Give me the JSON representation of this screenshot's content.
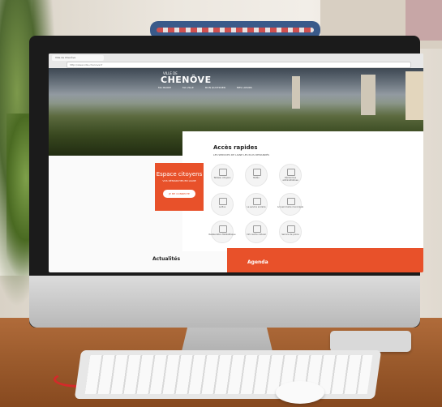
{
  "browser": {
    "tab_title": "Ville de Chenôve",
    "address": "http://www.ville-chenove.fr"
  },
  "site": {
    "logo_small": "VILLE DE",
    "logo_big": "CHENÔVE",
    "nav": [
      "MA MAIRIE",
      "MA VILLE",
      "MON QUOTIDIEN",
      "MES LOISIRS"
    ]
  },
  "acces_rapides": {
    "title": "Accès rapides",
    "subtitle": "LES SERVICES DE LIGNE LES PLUS DEMANDÉS",
    "tiles": [
      {
        "label": "Tableau citoyens",
        "icon": "document-icon"
      },
      {
        "label": "Météo",
        "icon": "cloud-icon"
      },
      {
        "label": "Démarches administratives",
        "icon": "form-icon"
      },
      {
        "label": "Le Bus",
        "icon": "bus-icon"
      },
      {
        "label": "Le service scolaire",
        "icon": "school-icon"
      },
      {
        "label": "Accueil mairie municipale",
        "icon": "city-hall-icon"
      },
      {
        "label": "Restauration Médiathèque",
        "icon": "library-icon"
      },
      {
        "label": "Info centre culturel",
        "icon": "calendar-icon"
      },
      {
        "label": "Service de police",
        "icon": "police-icon"
      }
    ]
  },
  "espace": {
    "title": "Espace citoyens",
    "subtitle": "VOS DÉMARCHES EN LIGNE",
    "button": "JE ME CONNECTE"
  },
  "sections": {
    "actualites": "Actualités",
    "agenda": "Agenda"
  },
  "colors": {
    "accent": "#e8512a"
  }
}
